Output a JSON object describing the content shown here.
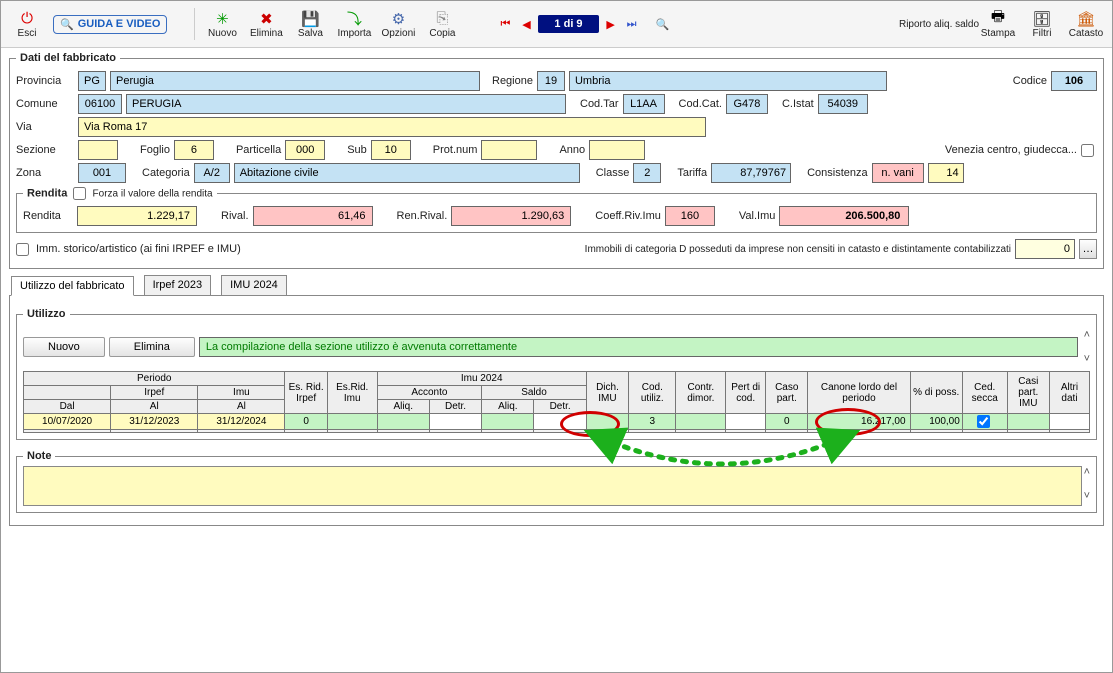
{
  "toolbar": {
    "esci": "Esci",
    "guida": "GUIDA E VIDEO",
    "nuovo": "Nuovo",
    "elimina": "Elimina",
    "salva": "Salva",
    "importa": "Importa",
    "opzioni": "Opzioni",
    "copia": "Copia",
    "pager": "1 di 9",
    "riporto": "Riporto aliq. saldo",
    "stampa": "Stampa",
    "filtri": "Filtri",
    "catasto": "Catasto"
  },
  "fabbricato": {
    "legend": "Dati del fabbricato",
    "provincia_lbl": "Provincia",
    "provincia_code": "PG",
    "provincia_name": "Perugia",
    "regione_lbl": "Regione",
    "regione_code": "19",
    "regione_name": "Umbria",
    "codice_lbl": "Codice",
    "codice_val": "106",
    "comune_lbl": "Comune",
    "comune_code": "06100",
    "comune_name": "PERUGIA",
    "codtar_lbl": "Cod.Tar",
    "codtar_val": "L1AA",
    "codcat_lbl": "Cod.Cat.",
    "codcat_val": "G478",
    "cistat_lbl": "C.Istat",
    "cistat_val": "54039",
    "via_lbl": "Via",
    "via_val": "Via Roma 17",
    "sezione_lbl": "Sezione",
    "sezione_val": "",
    "foglio_lbl": "Foglio",
    "foglio_val": "6",
    "particella_lbl": "Particella",
    "particella_val": "000",
    "sub_lbl": "Sub",
    "sub_val": "10",
    "protnum_lbl": "Prot.num",
    "protnum_val": "",
    "anno_lbl": "Anno",
    "anno_val": "",
    "venezia_lbl": "Venezia centro, giudecca...",
    "zona_lbl": "Zona",
    "zona_val": "001",
    "categoria_lbl": "Categoria",
    "categoria_val": "A/2",
    "categoria_desc": "Abitazione civile",
    "classe_lbl": "Classe",
    "classe_val": "2",
    "tariffa_lbl": "Tariffa",
    "tariffa_val": "87,79767",
    "consistenza_lbl": "Consistenza",
    "consistenza_unit": "n. vani",
    "consistenza_val": "14"
  },
  "rendita": {
    "legend": "Rendita",
    "forza_lbl": "Forza il valore della rendita",
    "rendita_lbl": "Rendita",
    "rendita_val": "1.229,17",
    "rival_lbl": "Rival.",
    "rival_val": "61,46",
    "renrival_lbl": "Ren.Rival.",
    "renrival_val": "1.290,63",
    "coeff_lbl": "Coeff.Riv.Imu",
    "coeff_val": "160",
    "valimu_lbl": "Val.Imu",
    "valimu_val": "206.500,80"
  },
  "storico": {
    "chk_lbl": "Imm. storico/artistico (ai fini IRPEF e IMU)",
    "info_lbl": "Immobili di categoria D posseduti da imprese non censiti in catasto e distintamente contabilizzati",
    "info_val": "0"
  },
  "tabs": {
    "t1": "Utilizzo del fabbricato",
    "t2": "Irpef 2023",
    "t3": "IMU 2024"
  },
  "utilizzo": {
    "legend": "Utilizzo",
    "nuovo_btn": "Nuovo",
    "elimina_btn": "Elimina",
    "msg": "La compilazione della sezione utilizzo è avvenuta correttamente",
    "headers": {
      "periodo": "Periodo",
      "irpef": "Irpef",
      "imu": "Imu",
      "dal": "Dal",
      "al": "Al",
      "al2": "Al",
      "esrid_irpef": "Es. Rid. Irpef",
      "esrid_imu": "Es.Rid. Imu",
      "imu2024": "Imu 2024",
      "acconto": "Acconto",
      "saldo": "Saldo",
      "aliq": "Aliq.",
      "detr": "Detr.",
      "dich_imu": "Dich. IMU",
      "cod_utiliz": "Cod. utiliz.",
      "contr_dimor": "Contr. dimor.",
      "pert_di_cod": "Pert di cod.",
      "caso_part": "Caso part.",
      "canone": "Canone lordo del periodo",
      "perc_poss": "% di poss.",
      "ced_secca": "Ced. secca",
      "casi_part_imu": "Casi part. IMU",
      "altri_dati": "Altri dati"
    },
    "row": {
      "dal": "10/07/2020",
      "irpef_al": "31/12/2023",
      "imu_al": "31/12/2024",
      "esrid_irpef": "0",
      "esrid_imu": "",
      "acc_aliq": "",
      "acc_detr": "",
      "sal_aliq": "",
      "sal_detr": "",
      "dich_imu": "",
      "cod_utiliz": "3",
      "contr_dimor": "",
      "pert_di_cod": "",
      "caso_part": "0",
      "canone": "16.217,00",
      "perc_poss": "100,00",
      "ced_secca": "☑",
      "casi_part_imu": "",
      "altri_dati": ""
    }
  },
  "note": {
    "legend": "Note",
    "text": ""
  }
}
